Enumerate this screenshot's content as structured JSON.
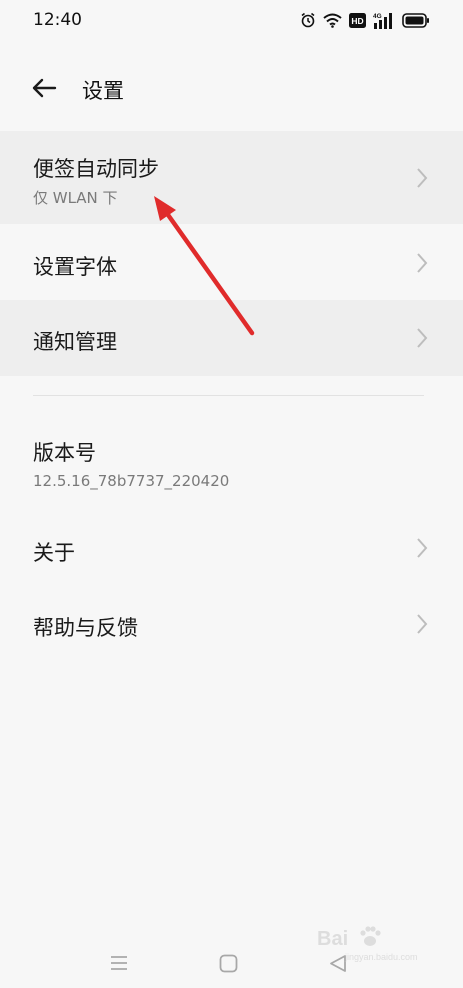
{
  "status_bar": {
    "time": "12:40",
    "icons": [
      "alarm-icon",
      "wifi-icon",
      "hd-icon",
      "signal-4g-icon",
      "battery-icon"
    ],
    "hd_label": "HD",
    "network_label": "4G"
  },
  "header": {
    "title": "设置",
    "back_icon": "arrow-left-icon"
  },
  "settings": {
    "sync": {
      "title": "便签自动同步",
      "subtitle": "仅 WLAN 下"
    },
    "font": {
      "title": "设置字体"
    },
    "notify": {
      "title": "通知管理"
    },
    "version": {
      "title": "版本号",
      "value": "12.5.16_78b7737_220420"
    },
    "about": {
      "title": "关于"
    },
    "help": {
      "title": "帮助与反馈"
    }
  },
  "nav_bar": {
    "icons": [
      "menu-icon",
      "home-icon",
      "back-triangle-icon"
    ]
  },
  "watermark": {
    "text": "Bai",
    "sub": "jingyan.baidu.com"
  },
  "colors": {
    "background": "#f7f7f7",
    "row_highlight": "#eeeeee",
    "annotation_arrow": "#e02b2b",
    "secondary_text": "#7a7a7a"
  }
}
